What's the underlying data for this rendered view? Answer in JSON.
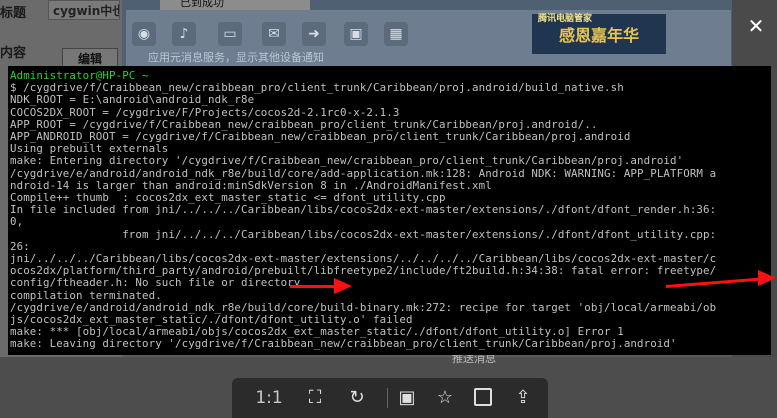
{
  "background": {
    "label_title": "标题",
    "label_content": "内容",
    "title_field_value": "cygwin中也",
    "edit_button": "编辑",
    "app_title": "已到成功",
    "banner_top": "腾讯电脑管家",
    "banner_main": "感恩嘉年华",
    "notice": "应用元消息服务，显示其他设备通知",
    "bottom_cn": "推送消息"
  },
  "terminal": {
    "lines": [
      {
        "text": "Administrator@HP-PC ~",
        "color": "green"
      },
      {
        "text": "$ /cygdrive/f/Craibbean_new/craibbean_pro/client_trunk/Caribbean/proj.android/build_native.sh",
        "color": "default"
      },
      {
        "text": "NDK_ROOT = E:\\android\\android_ndk_r8e",
        "color": "default"
      },
      {
        "text": "COCOS2DX_ROOT = /cygdrive/F/Projects/cocos2d-2.1rc0-x-2.1.3",
        "color": "default"
      },
      {
        "text": "APP_ROOT = /cygdrive/f/Craibbean_new/craibbean_pro/client_trunk/Caribbean/proj.android/..",
        "color": "default"
      },
      {
        "text": "APP_ANDROID_ROOT = /cygdrive/f/Craibbean_new/craibbean_pro/client_trunk/Caribbean/proj.android",
        "color": "default"
      },
      {
        "text": "Using prebuilt externals",
        "color": "default"
      },
      {
        "text": "make: Entering directory '/cygdrive/f/Craibbean_new/craibbean_pro/client_trunk/Caribbean/proj.android'",
        "color": "default"
      },
      {
        "text": "/cygdrive/e/android/android_ndk_r8e/build/core/add-application.mk:128: Android NDK: WARNING: APP_PLATFORM a",
        "color": "default"
      },
      {
        "text": "ndroid-14 is larger than android:minSdkVersion 8 in ./AndroidManifest.xml",
        "color": "default"
      },
      {
        "text": "Compile++ thumb  : cocos2dx_ext_master_static <= dfont_utility.cpp",
        "color": "default"
      },
      {
        "text": "In file included from jni/../../../Caribbean/libs/cocos2dx-ext-master/extensions/./dfont/dfont_render.h:36:",
        "color": "default"
      },
      {
        "text": "0,",
        "color": "default"
      },
      {
        "text": "                 from jni/../../../Caribbean/libs/cocos2dx-ext-master/extensions/./dfont/dfont_utility.cpp:",
        "color": "default"
      },
      {
        "text": "26:",
        "color": "default"
      },
      {
        "text": "jni/../../../Caribbean/libs/cocos2dx-ext-master/extensions/../../../../Caribbean/libs/cocos2dx-ext-master/c",
        "color": "default"
      },
      {
        "text": "ocos2dx/platform/third_party/android/prebuilt/libfreetype2/include/ft2build.h:34:38: fatal error: freetype/",
        "color": "default"
      },
      {
        "text": "config/ftheader.h: No such file or directory",
        "color": "default"
      },
      {
        "text": "compilation terminated.",
        "color": "default"
      },
      {
        "text": "/cygdrive/e/android/android_ndk_r8e/build/core/build-binary.mk:272: recipe for target 'obj/local/armeabi/ob",
        "color": "default"
      },
      {
        "text": "js/cocos2dx_ext_master_static/./dfont/dfont_utility.o' failed",
        "color": "default"
      },
      {
        "text": "make: *** [obj/local/armeabi/objs/cocos2dx_ext_master_static/./dfont/dfont_utility.o] Error 1",
        "color": "default"
      },
      {
        "text": "make: Leaving directory '/cygdrive/f/Craibbean_new/craibbean_pro/client_trunk/Caribbean/proj.android'",
        "color": "default"
      }
    ]
  },
  "viewer": {
    "ratio_label": "1:1",
    "close_glyph": "✕"
  },
  "colors": {
    "terminal_bg": "#000000",
    "prompt_green": "#2bd12b",
    "arrow_red": "#ff1010"
  }
}
